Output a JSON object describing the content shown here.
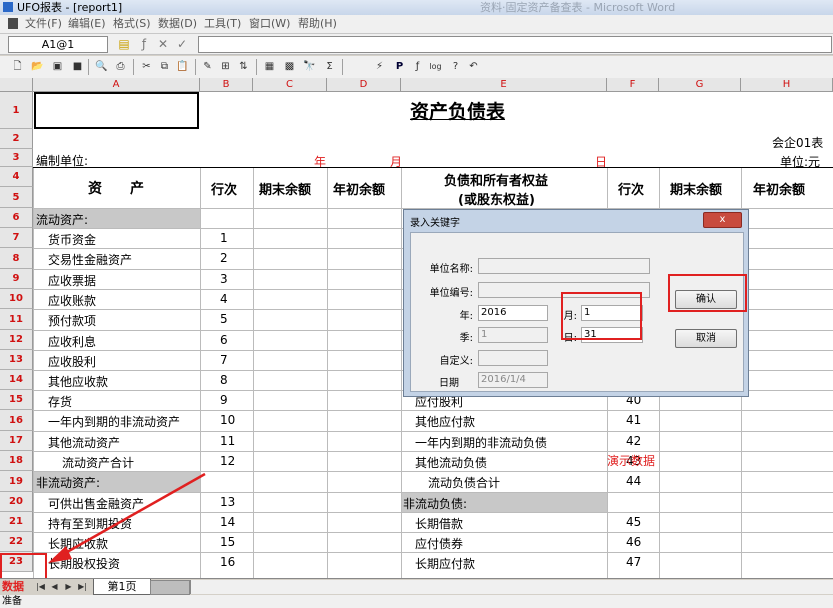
{
  "window": {
    "title": "UFO报表 - [report1]",
    "faint_title": "资料·固定资产备查表 - Microsoft Word"
  },
  "menu": [
    "文件(F)",
    "编辑(E)",
    "格式(S)",
    "数据(D)",
    "工具(T)",
    "窗口(W)",
    "帮助(H)"
  ],
  "formula_bar": {
    "cell_ref": "A1@1",
    "value": ""
  },
  "columns": [
    "A",
    "B",
    "C",
    "D",
    "E",
    "F",
    "G",
    "H"
  ],
  "rows": [
    "1",
    "2",
    "3",
    "4",
    "5",
    "6",
    "7",
    "8",
    "9",
    "10",
    "11",
    "12",
    "13",
    "14",
    "15",
    "16",
    "17",
    "18",
    "19",
    "20",
    "21",
    "22",
    "23"
  ],
  "report": {
    "title": "资产负债表",
    "form_no": "会企01表",
    "unit_label": "编制单位:",
    "year": "年",
    "month": "月",
    "day": "日",
    "currency_unit": "单位:元",
    "headers": {
      "assets": "资　　产",
      "line": "行次",
      "end_balance": "期末余额",
      "begin_balance": "年初余额",
      "liab_1": "负债和所有者权益",
      "liab_2": "(或股东权益)",
      "line2": "行次",
      "end_balance2": "期末余额",
      "begin_balance2": "年初余额"
    },
    "left_rows": [
      {
        "name": "流动资产:",
        "line": ""
      },
      {
        "name": "货币资金",
        "line": "1"
      },
      {
        "name": "交易性金融资产",
        "line": "2"
      },
      {
        "name": "应收票据",
        "line": "3"
      },
      {
        "name": "应收账款",
        "line": "4"
      },
      {
        "name": "预付款项",
        "line": "5"
      },
      {
        "name": "应收利息",
        "line": "6"
      },
      {
        "name": "应收股利",
        "line": "7"
      },
      {
        "name": "其他应收款",
        "line": "8"
      },
      {
        "name": "存货",
        "line": "9"
      },
      {
        "name": "一年内到期的非流动资产",
        "line": "10"
      },
      {
        "name": "其他流动资产",
        "line": "11"
      },
      {
        "name": "流动资产合计",
        "line": "12"
      },
      {
        "name": "非流动资产:",
        "line": ""
      },
      {
        "name": "可供出售金融资产",
        "line": "13"
      },
      {
        "name": "持有至到期投资",
        "line": "14"
      },
      {
        "name": "长期应收款",
        "line": "15"
      },
      {
        "name": "长期股权投资",
        "line": "16"
      }
    ],
    "right_rows": [
      {
        "name": "应付股利",
        "line": "40"
      },
      {
        "name": "其他应付款",
        "line": "41"
      },
      {
        "name": "一年内到期的非流动负债",
        "line": "42"
      },
      {
        "name": "其他流动负债",
        "line": "43"
      },
      {
        "name": "流动负债合计",
        "line": "44"
      },
      {
        "name": "非流动负债:",
        "line": ""
      },
      {
        "name": "长期借款",
        "line": "45"
      },
      {
        "name": "应付债券",
        "line": "46"
      },
      {
        "name": "长期应付款",
        "line": "47"
      }
    ],
    "demo_watermark": "演示数据"
  },
  "dialog": {
    "title": "录入关键字",
    "unit_name_label": "单位名称:",
    "unit_name_value": "",
    "unit_code_label": "单位编号:",
    "unit_code_value": "",
    "year_label": "年:",
    "year_value": "2016",
    "month_label": "月:",
    "month_value": "1",
    "quarter_label": "季:",
    "quarter_value": "1",
    "day_label": "日:",
    "day_value": "31",
    "custom_label": "自定义:",
    "custom_value": "",
    "date_label": "日期",
    "date_value": "2016/1/4",
    "confirm_label": "确认",
    "cancel_label": "取消",
    "close_label": "x"
  },
  "sheet_tab": "第1页",
  "mode_label": "数据",
  "status_text": "准备",
  "colors": {
    "accent_red": "#e02020",
    "header_red": "#d01010"
  }
}
